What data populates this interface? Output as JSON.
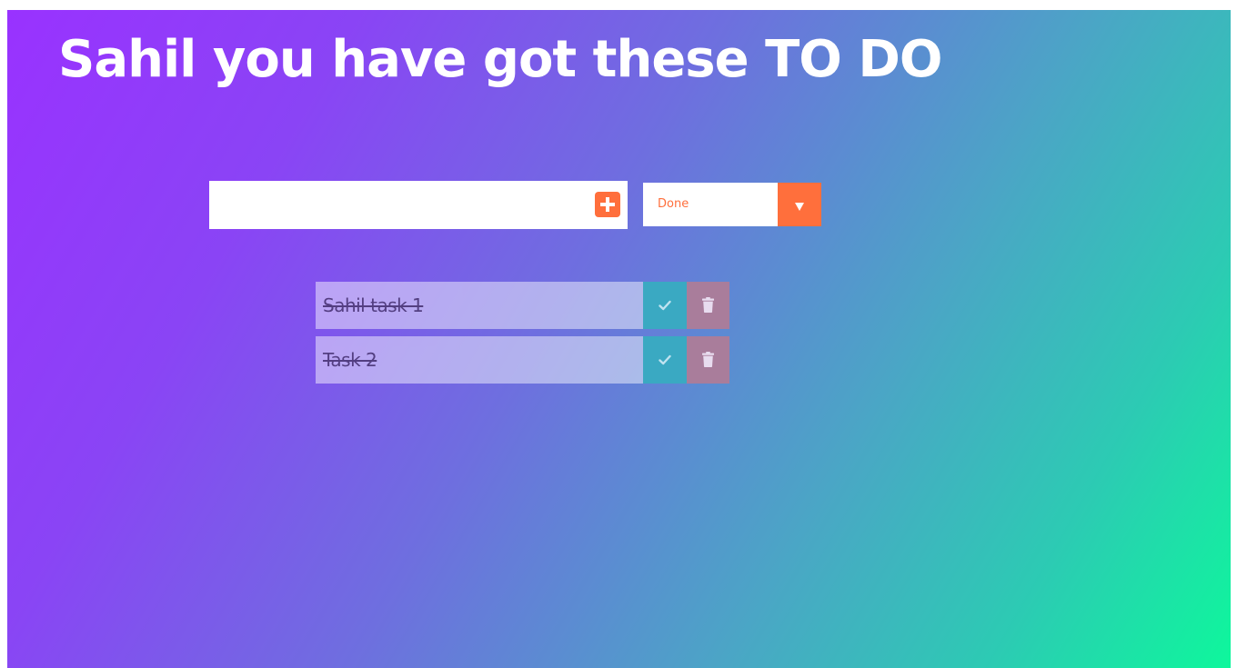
{
  "header": {
    "title": "Sahil you have got these TO DO"
  },
  "form": {
    "input_value": "",
    "input_placeholder": "",
    "add_icon": "plus-square-icon",
    "filter_selected": "Done",
    "filter_icon": "caret-down-icon"
  },
  "todos": [
    {
      "text": "Sahil task 1",
      "completed": true,
      "complete_icon": "check-icon",
      "delete_icon": "trash-icon"
    },
    {
      "text": "Task 2",
      "completed": true,
      "complete_icon": "check-icon",
      "delete_icon": "trash-icon"
    }
  ],
  "colors": {
    "accent": "#ff6f3c",
    "complete": "#3aa9c2",
    "delete": "#a97d9b",
    "gradient_start": "#9932ff",
    "gradient_end": "#0ef79c"
  }
}
